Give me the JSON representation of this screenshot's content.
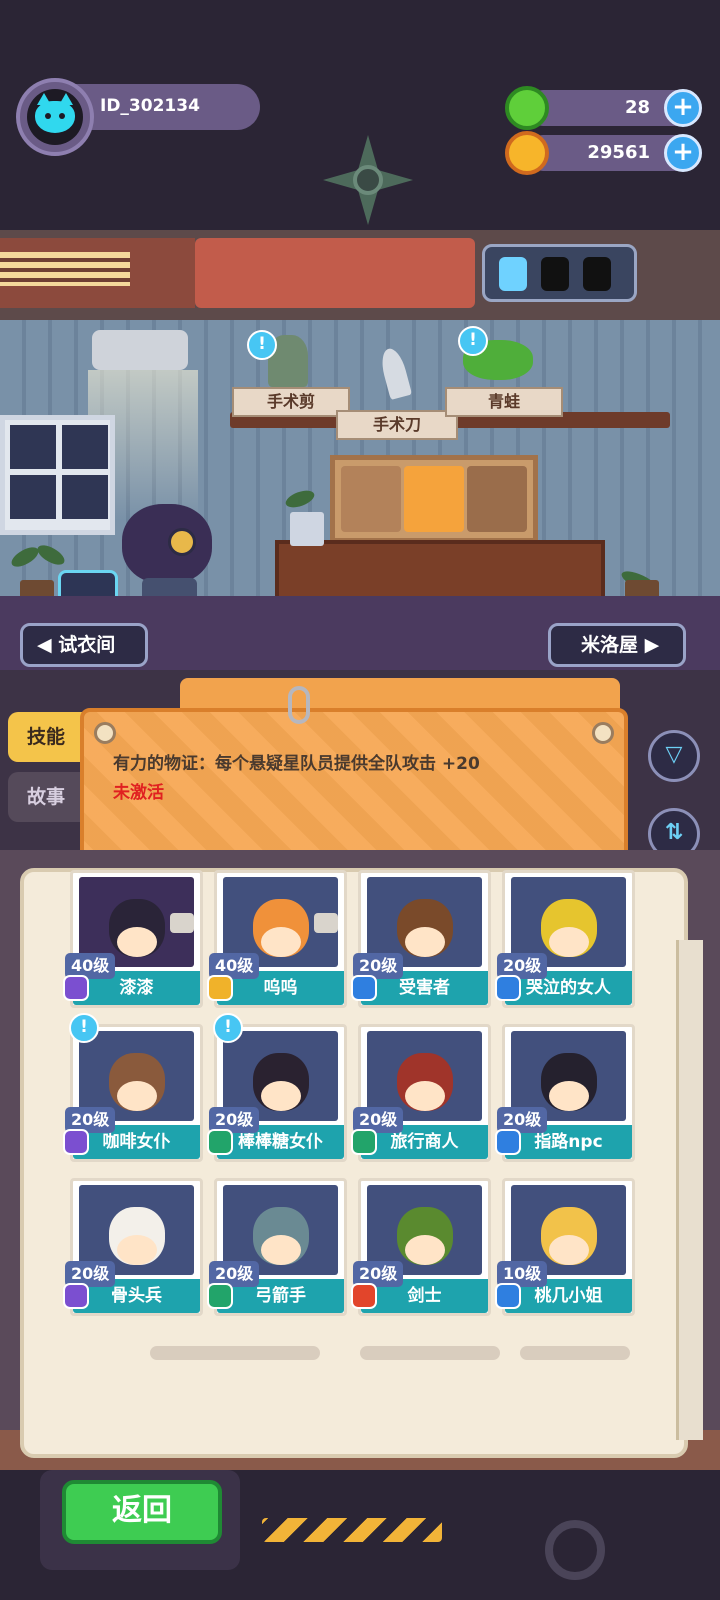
{
  "player": {
    "id": "ID_302134"
  },
  "resources": [
    {
      "name": "gem",
      "value": "28",
      "color": "#5fcf3a"
    },
    {
      "name": "coin",
      "value": "29561",
      "color": "#f7b52a"
    }
  ],
  "room": {
    "shelf_labels": [
      "手术剪",
      "手术刀",
      "青蛙"
    ],
    "left_nav": "试衣间",
    "right_nav": "米洛屋"
  },
  "side_tabs": [
    {
      "label": "技能",
      "active": true
    },
    {
      "label": "故事",
      "active": false
    }
  ],
  "skill": {
    "description": "有力的物证：每个悬疑星队员提供全队攻击 +20",
    "status": "未激活"
  },
  "cards": [
    {
      "name": "漆漆",
      "level": "40级",
      "element": "purple",
      "art": "#3d2f5a",
      "char": "#2a2438",
      "shirt": true,
      "bubble": false
    },
    {
      "name": "呜呜",
      "level": "40级",
      "element": "yellow",
      "art": "#42507d",
      "char": "#f0913a",
      "shirt": true,
      "bubble": false
    },
    {
      "name": "受害者",
      "level": "20级",
      "element": "blue",
      "art": "#42507d",
      "char": "#7a4a2a",
      "shirt": false,
      "bubble": false
    },
    {
      "name": "哭泣的女人",
      "level": "20级",
      "element": "blue",
      "art": "#42507d",
      "char": "#e6c52e",
      "shirt": false,
      "bubble": false
    },
    {
      "name": "咖啡女仆",
      "level": "20级",
      "element": "purple",
      "art": "#42507d",
      "char": "#8a5a3c",
      "shirt": false,
      "bubble": true
    },
    {
      "name": "棒棒糖女仆",
      "level": "20级",
      "element": "green",
      "art": "#42507d",
      "char": "#2a2230",
      "shirt": false,
      "bubble": true
    },
    {
      "name": "旅行商人",
      "level": "20级",
      "element": "green",
      "art": "#42507d",
      "char": "#a0342a",
      "shirt": false,
      "bubble": false
    },
    {
      "name": "指路npc",
      "level": "20级",
      "element": "blue",
      "art": "#42507d",
      "char": "#25212e",
      "shirt": false,
      "bubble": false
    },
    {
      "name": "骨头兵",
      "level": "20级",
      "element": "purple",
      "art": "#42507d",
      "char": "#f3f0ea",
      "shirt": false,
      "bubble": false
    },
    {
      "name": "弓箭手",
      "level": "20级",
      "element": "green",
      "art": "#42507d",
      "char": "#6a8a93",
      "shirt": false,
      "bubble": false
    },
    {
      "name": "剑士",
      "level": "20级",
      "element": "red",
      "art": "#42507d",
      "char": "#5a8a2f",
      "shirt": false,
      "bubble": false
    },
    {
      "name": "桃几小姐",
      "level": "10级",
      "element": "blue",
      "art": "#42507d",
      "char": "#f2c24a",
      "shirt": false,
      "bubble": false
    }
  ],
  "element_colors": {
    "purple": "#7b4fd0",
    "yellow": "#f0b22a",
    "blue": "#2f7fe0",
    "green": "#22a46a",
    "red": "#e2452b"
  },
  "footer": {
    "back_label": "返回"
  }
}
